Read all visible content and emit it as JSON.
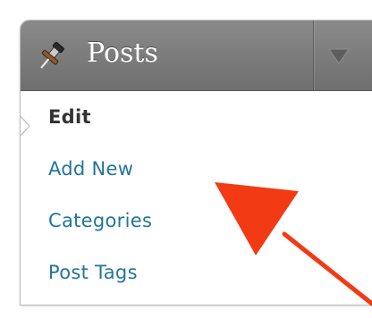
{
  "menu": {
    "title": "Posts",
    "header_icon": "pushpin-icon",
    "toggle_icon": "triangle-down-icon",
    "items": [
      {
        "label": "Edit",
        "current": true
      },
      {
        "label": "Add New",
        "current": false
      },
      {
        "label": "Categories",
        "current": false
      },
      {
        "label": "Post Tags",
        "current": false
      }
    ]
  },
  "annotation": {
    "icon": "red-arrow-pointer",
    "color": "#f23a14"
  },
  "colors": {
    "header_bg": "#7a7a7a",
    "link": "#21759b",
    "current_text": "#333333"
  }
}
